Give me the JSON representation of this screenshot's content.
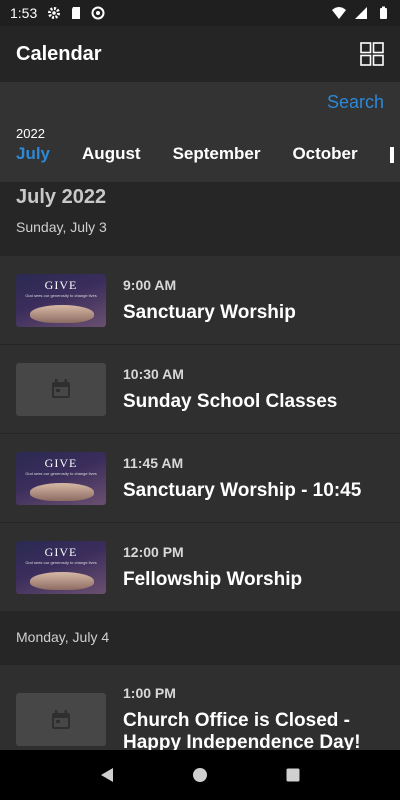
{
  "status_bar": {
    "time": "1:53"
  },
  "app_bar": {
    "title": "Calendar"
  },
  "filter": {
    "search_label": "Search",
    "year": "2022",
    "months": [
      "July",
      "August",
      "September",
      "October"
    ],
    "active_month": "July"
  },
  "sections": [
    {
      "month_title": "July 2022",
      "day": "Sunday, July 3",
      "events": [
        {
          "time": "9:00 AM",
          "title": "Sanctuary Worship",
          "thumb": "give"
        },
        {
          "time": "10:30 AM",
          "title": "Sunday School Classes",
          "thumb": "placeholder"
        },
        {
          "time": "11:45 AM",
          "title": "Sanctuary Worship - 10:45",
          "thumb": "give"
        },
        {
          "time": "12:00 PM",
          "title": "Fellowship Worship",
          "thumb": "give"
        }
      ]
    },
    {
      "day": "Monday, July 4",
      "events": [
        {
          "time": "1:00 PM",
          "title": "Church Office is Closed - Happy Independence Day!",
          "thumb": "placeholder"
        }
      ]
    }
  ],
  "thumb_text": {
    "give": "GIVE",
    "give_sub": "God sees our generosity to change lives"
  },
  "colors": {
    "accent": "#2d88d6",
    "app_bar": "#252525",
    "filter_bg": "#333333",
    "row_bg": "#2f2f2f"
  },
  "icons": {
    "status_left": [
      "gear-icon",
      "sd-card-icon",
      "vpn-icon"
    ],
    "status_right": [
      "wifi-icon",
      "signal-icon",
      "battery-icon"
    ],
    "app_bar": "grid-view-icon",
    "placeholder": "calendar-icon",
    "nav": [
      "back-icon",
      "home-icon",
      "recents-icon"
    ]
  }
}
